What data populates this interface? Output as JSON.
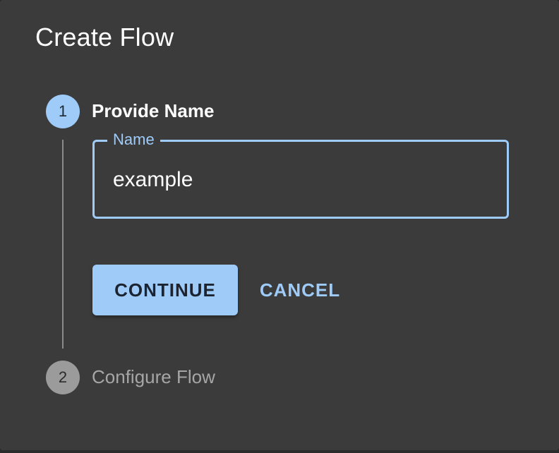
{
  "dialog": {
    "title": "Create Flow"
  },
  "stepper": {
    "steps": [
      {
        "number": "1",
        "label": "Provide Name",
        "state": "active"
      },
      {
        "number": "2",
        "label": "Configure Flow",
        "state": "inactive"
      }
    ]
  },
  "name_field": {
    "label": "Name",
    "value": "example"
  },
  "actions": {
    "continue_label": "CONTINUE",
    "cancel_label": "CANCEL"
  },
  "colors": {
    "dialog_background": "#3b3b3c",
    "accent": "#9ecbf7",
    "inactive_step": "#9b9b9b",
    "inactive_text": "#a6a6a6"
  }
}
